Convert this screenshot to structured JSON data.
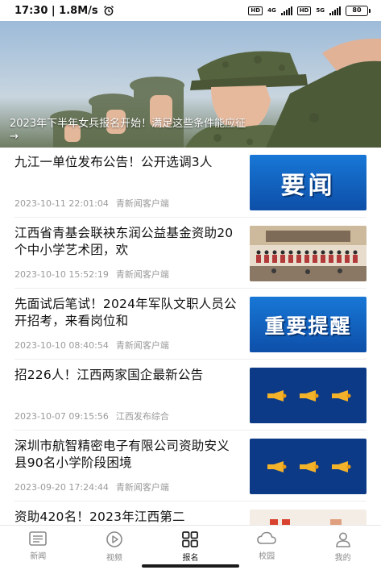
{
  "status_bar": {
    "time_speed": "17:30 | 1.8M/s",
    "alarm_icon": "alarm-clock-icon",
    "hd1": "HD",
    "net1": "4G",
    "hd2": "HD",
    "net2": "5G",
    "battery": "80"
  },
  "hero": {
    "caption": "2023年下半年女兵报名开始！满足这些条件能应征→"
  },
  "news": [
    {
      "title": "九江一单位发布公告！公开选调3人",
      "date": "2023-10-11 22:01:04",
      "source": "青新闻客户端",
      "thumb_text": "要闻"
    },
    {
      "title": "江西省青基会联袂东润公益基金资助20个中小学艺术团，欢",
      "date": "2023-10-10 15:52:19",
      "source": "青新闻客户端",
      "thumb_text": ""
    },
    {
      "title": "先面试后笔试！2024年军队文职人员公开招考，来看岗位和",
      "date": "2023-10-10 08:40:54",
      "source": "青新闻客户端",
      "thumb_text": "重要提醒"
    },
    {
      "title": "招226人！江西两家国企最新公告",
      "date": "2023-10-07 09:15:56",
      "source": "江西发布综合",
      "thumb_text": ""
    },
    {
      "title": "深圳市航智精密电子有限公司资助安义县90名小学阶段困境",
      "date": "2023-09-20 17:24:44",
      "source": "青新闻客户端",
      "thumb_text": ""
    },
    {
      "title": "资助420名！2023年江西第二",
      "date": "",
      "source": "",
      "thumb_text": ""
    }
  ],
  "tabs": [
    {
      "label": "新闻",
      "icon": "news-icon"
    },
    {
      "label": "视频",
      "icon": "play-circle-icon"
    },
    {
      "label": "报名",
      "icon": "grid-icon"
    },
    {
      "label": "校园",
      "icon": "cloud-icon"
    },
    {
      "label": "我的",
      "icon": "user-icon"
    }
  ],
  "colors": {
    "thumb_blue": "#1877d6",
    "thumb_navy": "#0d3a86",
    "horn_gold": "#f2b32a"
  }
}
